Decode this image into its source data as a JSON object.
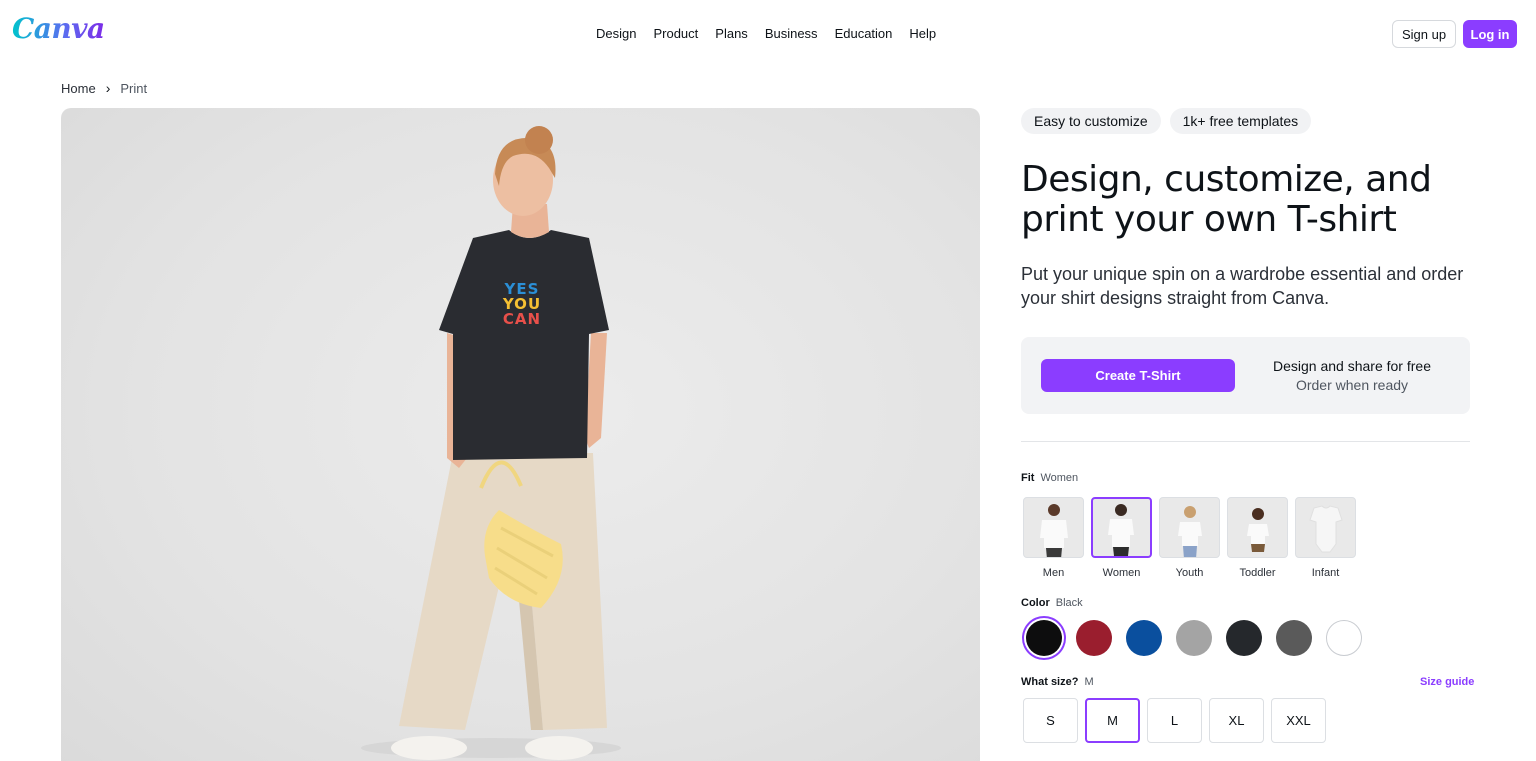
{
  "header": {
    "logo": "Canva",
    "nav": [
      "Design",
      "Product",
      "Plans",
      "Business",
      "Education",
      "Help"
    ],
    "signup_label": "Sign up",
    "login_label": "Log in"
  },
  "breadcrumb": {
    "home": "Home",
    "current": "Print"
  },
  "hero": {
    "shirt_text": [
      "YES",
      "YOU",
      "CAN"
    ],
    "colors": {
      "yes": "#2b8fd6",
      "you": "#f5c033",
      "can": "#e8504a",
      "shirt": "#2a2c31"
    }
  },
  "product": {
    "chips": [
      "Easy to customize",
      "1k+ free templates"
    ],
    "title": "Design, customize, and print your own T-shirt",
    "subtitle": "Put your unique spin on a wardrobe essential and order your shirt designs straight from Canva.",
    "cta_label": "Create T-Shirt",
    "cta_line1": "Design and share for free",
    "cta_line2": "Order when ready"
  },
  "fit": {
    "label": "Fit",
    "selected": "Women",
    "options": [
      "Men",
      "Women",
      "Youth",
      "Toddler",
      "Infant"
    ]
  },
  "color": {
    "label": "Color",
    "selected": "Black",
    "swatches": [
      "#0d0d0e",
      "#9a1e2e",
      "#0a4f9e",
      "#a4a4a4",
      "#25282c",
      "#5a5a5a",
      "#ffffff"
    ]
  },
  "size": {
    "label": "What size?",
    "selected": "M",
    "guide_label": "Size guide",
    "options": [
      "S",
      "M",
      "L",
      "XL",
      "XXL"
    ]
  },
  "accent_color": "#8b3dff"
}
